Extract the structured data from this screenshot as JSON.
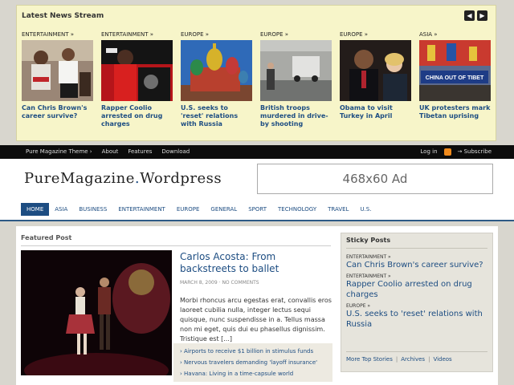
{
  "news_stream": {
    "title": "Latest News Stream",
    "items": [
      {
        "category": "ENTERTAINMENT »",
        "headline": "Can Chris Brown's career survive?"
      },
      {
        "category": "ENTERTAINMENT »",
        "headline": "Rapper Coolio arrested on drug charges"
      },
      {
        "category": "EUROPE »",
        "headline": "U.S. seeks to 'reset' relations with Russia"
      },
      {
        "category": "EUROPE »",
        "headline": "British troops murdered in drive-by shooting"
      },
      {
        "category": "EUROPE »",
        "headline": "Obama to visit Turkey in April"
      },
      {
        "category": "ASIA »",
        "headline": "UK protesters mark Tibetan uprising"
      }
    ],
    "protest_banner": "CHINA OUT OF TIBET"
  },
  "topbar": {
    "links": [
      "Pure Magazine Theme ›",
      "About",
      "Features",
      "Download"
    ],
    "login": "Log in",
    "subscribe": "→ Subscribe"
  },
  "header": {
    "logo_main": "PureMagazine",
    "logo_dot": ".",
    "logo_rest": "Wordpress",
    "ad_text": "468x60 Ad"
  },
  "nav": {
    "items": [
      "HOME",
      "ASIA",
      "BUSINESS",
      "ENTERTAINMENT",
      "EUROPE",
      "GENERAL",
      "SPORT",
      "TECHNOLOGY",
      "TRAVEL",
      "U.S."
    ]
  },
  "featured": {
    "section_title": "Featured Post",
    "title": "Carlos Acosta: From backstreets to ballet",
    "date": "MARCH 8, 2009",
    "meta_sep": "·",
    "comments": "NO COMMENTS",
    "excerpt": "Morbi rhoncus arcu egestas erat, convallis eros laoreet cubilia nulla, integer lectus sequi quisque, nunc suspendisse in a. Tellus massa non mi eget, quis dui eu phasellus dignissim. Tristique est [...]",
    "related": [
      "› Airports to receive $1 billion in stimulus funds",
      "› Nervous travelers demanding 'layoff insurance'",
      "› Havana: Living in a time-capsule world"
    ]
  },
  "sticky": {
    "title": "Sticky Posts",
    "items": [
      {
        "category": "ENTERTAINMENT »",
        "headline": "Can Chris Brown's career survive?"
      },
      {
        "category": "ENTERTAINMENT »",
        "headline": "Rapper Coolio arrested on drug charges"
      },
      {
        "category": "EUROPE »",
        "headline": "U.S. seeks to 'reset' relations with Russia"
      }
    ],
    "footer_links": [
      "More Top Stories",
      "Archives",
      "Videos"
    ]
  },
  "colors": {
    "link_blue": "#1d4d82",
    "stream_bg": "#f7f5c9",
    "topbar_bg": "#0c0c0c",
    "rss_orange": "#f08a1c"
  }
}
